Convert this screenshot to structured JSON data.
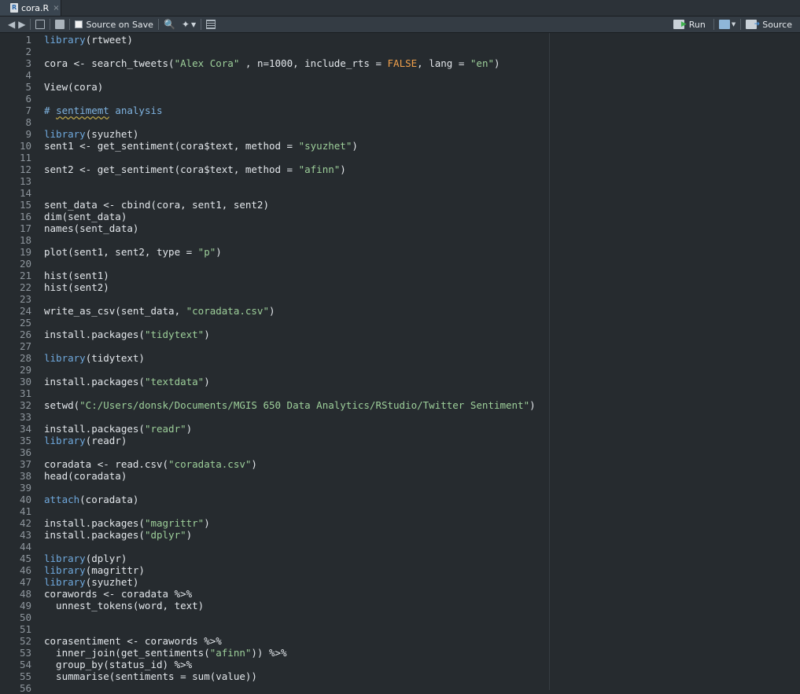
{
  "tab": {
    "filename": "cora.R",
    "close": "×"
  },
  "toolbar": {
    "source_on_save": "Source on Save",
    "run": "Run",
    "source": "Source"
  },
  "colors": {
    "background": "#262b2f",
    "text": "#e3e7eb",
    "keyword": "#6fa8dc",
    "string": "#9dcf9a",
    "constant": "#f0a04b",
    "line_number": "#8e969d"
  },
  "lines": [
    [
      [
        "kw",
        "library"
      ],
      [
        "t",
        "(rtweet)"
      ]
    ],
    [],
    [
      [
        "t",
        "cora <- search_tweets("
      ],
      [
        "s",
        "\"Alex Cora\""
      ],
      [
        "t",
        " , n=1000, include_rts = "
      ],
      [
        "c",
        "FALSE"
      ],
      [
        "t",
        ", lang = "
      ],
      [
        "s",
        "\"en\""
      ],
      [
        "t",
        ")"
      ]
    ],
    [],
    [
      [
        "t",
        "View(cora)"
      ]
    ],
    [],
    [
      [
        "cm",
        "# "
      ],
      [
        "cmu",
        "sentimemt"
      ],
      [
        "cm",
        " analysis"
      ]
    ],
    [],
    [
      [
        "kw",
        "library"
      ],
      [
        "t",
        "(syuzhet)"
      ]
    ],
    [
      [
        "t",
        "sent1 <- get_sentiment(cora$text, method = "
      ],
      [
        "s",
        "\"syuzhet\""
      ],
      [
        "t",
        ")"
      ]
    ],
    [],
    [
      [
        "t",
        "sent2 <- get_sentiment(cora$text, method = "
      ],
      [
        "s",
        "\"afinn\""
      ],
      [
        "t",
        ")"
      ]
    ],
    [],
    [],
    [
      [
        "t",
        "sent_data <- cbind(cora, sent1, sent2)"
      ]
    ],
    [
      [
        "t",
        "dim(sent_data)"
      ]
    ],
    [
      [
        "t",
        "names(sent_data)"
      ]
    ],
    [],
    [
      [
        "t",
        "plot(sent1, sent2, type = "
      ],
      [
        "s",
        "\"p\""
      ],
      [
        "t",
        ")"
      ]
    ],
    [],
    [
      [
        "t",
        "hist(sent1)"
      ]
    ],
    [
      [
        "t",
        "hist(sent2)"
      ]
    ],
    [],
    [
      [
        "t",
        "write_as_csv(sent_data, "
      ],
      [
        "s",
        "\"coradata.csv\""
      ],
      [
        "t",
        ")"
      ]
    ],
    [],
    [
      [
        "t",
        "install.packages("
      ],
      [
        "s",
        "\"tidytext\""
      ],
      [
        "t",
        ")"
      ]
    ],
    [],
    [
      [
        "kw",
        "library"
      ],
      [
        "t",
        "(tidytext)"
      ]
    ],
    [],
    [
      [
        "t",
        "install.packages("
      ],
      [
        "s",
        "\"textdata\""
      ],
      [
        "t",
        ")"
      ]
    ],
    [],
    [
      [
        "t",
        "setwd("
      ],
      [
        "s",
        "\"C:/Users/donsk/Documents/MGIS 650 Data Analytics/RStudio/Twitter Sentiment\""
      ],
      [
        "t",
        ")"
      ]
    ],
    [],
    [
      [
        "t",
        "install.packages("
      ],
      [
        "s",
        "\"readr\""
      ],
      [
        "t",
        ")"
      ]
    ],
    [
      [
        "kw",
        "library"
      ],
      [
        "t",
        "(readr)"
      ]
    ],
    [],
    [
      [
        "t",
        "coradata <- read.csv("
      ],
      [
        "s",
        "\"coradata.csv\""
      ],
      [
        "t",
        ")"
      ]
    ],
    [
      [
        "t",
        "head(coradata)"
      ]
    ],
    [],
    [
      [
        "kw",
        "attach"
      ],
      [
        "t",
        "(coradata)"
      ]
    ],
    [],
    [
      [
        "t",
        "install.packages("
      ],
      [
        "s",
        "\"magrittr\""
      ],
      [
        "t",
        ")"
      ]
    ],
    [
      [
        "t",
        "install.packages("
      ],
      [
        "s",
        "\"dplyr\""
      ],
      [
        "t",
        ")"
      ]
    ],
    [],
    [
      [
        "kw",
        "library"
      ],
      [
        "t",
        "(dplyr)"
      ]
    ],
    [
      [
        "kw",
        "library"
      ],
      [
        "t",
        "(magrittr)"
      ]
    ],
    [
      [
        "kw",
        "library"
      ],
      [
        "t",
        "(syuzhet)"
      ]
    ],
    [
      [
        "t",
        "corawords <- coradata %>%"
      ]
    ],
    [
      [
        "t",
        "  unnest_tokens(word, text)"
      ]
    ],
    [],
    [],
    [
      [
        "t",
        "corasentiment <- corawords %>%"
      ]
    ],
    [
      [
        "t",
        "  inner_join(get_sentiments("
      ],
      [
        "s",
        "\"afinn\""
      ],
      [
        "t",
        ")) %>%"
      ]
    ],
    [
      [
        "t",
        "  group_by(status_id) %>%"
      ]
    ],
    [
      [
        "t",
        "  summarise(sentiments = sum(value))"
      ]
    ],
    []
  ]
}
